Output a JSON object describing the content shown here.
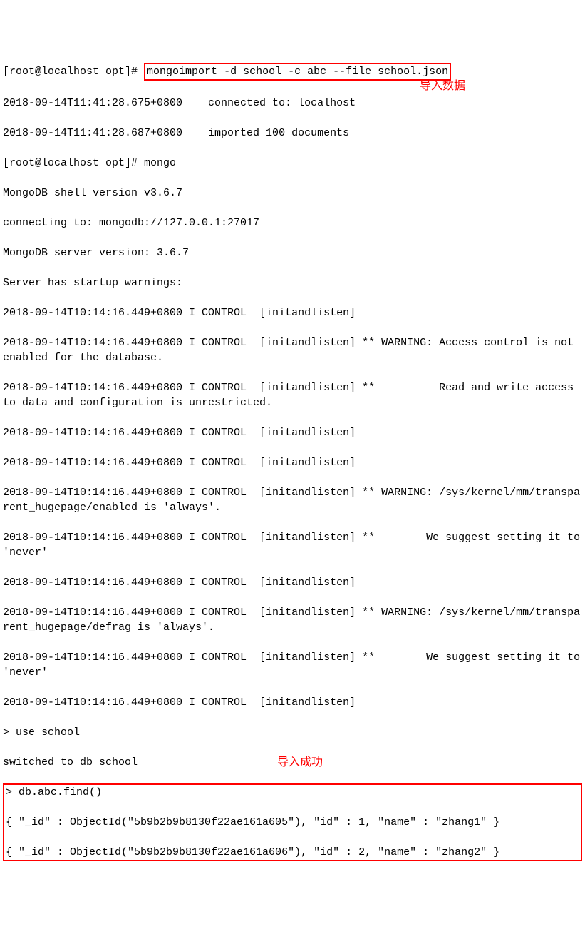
{
  "prompt1": "[root@localhost opt]# ",
  "cmd1": "mongoimport -d school -c abc --file school.json",
  "ann1": "导入数据",
  "l1": "2018-09-14T11:41:28.675+0800    connected to: localhost",
  "l2": "2018-09-14T11:41:28.687+0800    imported 100 documents",
  "prompt2": "[root@localhost opt]# mongo",
  "l3": "MongoDB shell version v3.6.7",
  "l4": "connecting to: mongodb://127.0.0.1:27017",
  "l5": "MongoDB server version: 3.6.7",
  "l6": "Server has startup warnings: ",
  "l7": "2018-09-14T10:14:16.449+0800 I CONTROL  [initandlisten] ",
  "l8": "2018-09-14T10:14:16.449+0800 I CONTROL  [initandlisten] ** WARNING: Access control is not enabled for the database.",
  "l9": "2018-09-14T10:14:16.449+0800 I CONTROL  [initandlisten] **          Read and write access to data and configuration is unrestricted.",
  "l10": "2018-09-14T10:14:16.449+0800 I CONTROL  [initandlisten] ",
  "l11": "2018-09-14T10:14:16.449+0800 I CONTROL  [initandlisten] ",
  "l12": "2018-09-14T10:14:16.449+0800 I CONTROL  [initandlisten] ** WARNING: /sys/kernel/mm/transparent_hugepage/enabled is 'always'.",
  "l13": "2018-09-14T10:14:16.449+0800 I CONTROL  [initandlisten] **        We suggest setting it to 'never'",
  "l14": "2018-09-14T10:14:16.449+0800 I CONTROL  [initandlisten] ",
  "l15": "2018-09-14T10:14:16.449+0800 I CONTROL  [initandlisten] ** WARNING: /sys/kernel/mm/transparent_hugepage/defrag is 'always'.",
  "l16": "2018-09-14T10:14:16.449+0800 I CONTROL  [initandlisten] **        We suggest setting it to 'never'",
  "l17": "2018-09-14T10:14:16.449+0800 I CONTROL  [initandlisten] ",
  "l18": "> use school",
  "l19": "switched to db school",
  "ann2": "导入成功",
  "q1": "> db.abc.find()",
  "q2": "{ \"_id\" : ObjectId(\"5b9b2b9b8130f22ae161a605\"), \"id\" : 1, \"name\" : \"zhang1\" }",
  "q3": "{ \"_id\" : ObjectId(\"5b9b2b9b8130f22ae161a606\"), \"id\" : 2, \"name\" : \"zhang2\" }"
}
